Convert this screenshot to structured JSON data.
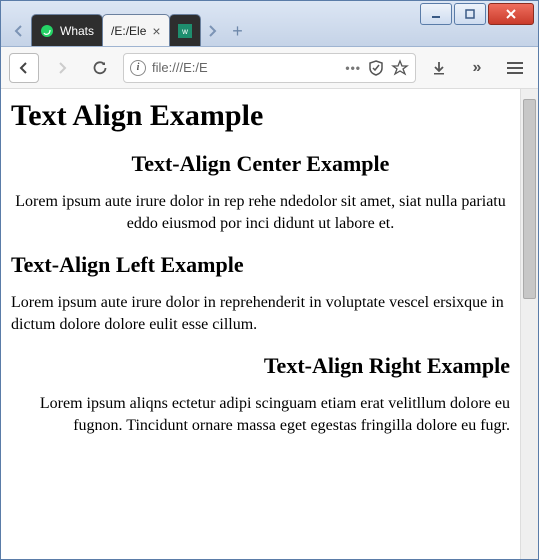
{
  "tabs": {
    "prev_hidden": true,
    "items": [
      {
        "label": "Whats",
        "active": false,
        "favicon_color": "#25d366"
      },
      {
        "label": "/E:/Ele",
        "active": true,
        "favicon_color": "#888"
      }
    ],
    "overflow_favicon_bg": "#1e8e6e"
  },
  "urlbar": {
    "prefix": "file:///E:/E",
    "dots": "•••"
  },
  "page": {
    "h1": "Text Align Example",
    "sections": [
      {
        "align": "center",
        "heading": "Text-Align Center Example",
        "body": "Lorem ipsum aute irure dolor in rep rehe ndedolor sit amet, siat nulla pariatu eddo eiusmod por inci didunt ut labore et."
      },
      {
        "align": "left",
        "heading": "Text-Align Left Example",
        "body": "Lorem ipsum aute irure dolor in reprehenderit in voluptate vescel ersixque in dictum dolore dolore eulit esse cillum."
      },
      {
        "align": "right",
        "heading": "Text-Align Right Example",
        "body": "Lorem ipsum aliqns ectetur adipi scinguam etiam erat velitllum dolore eu fugnon. Tincidunt ornare massa eget egestas fringilla dolore eu fugr."
      }
    ]
  }
}
